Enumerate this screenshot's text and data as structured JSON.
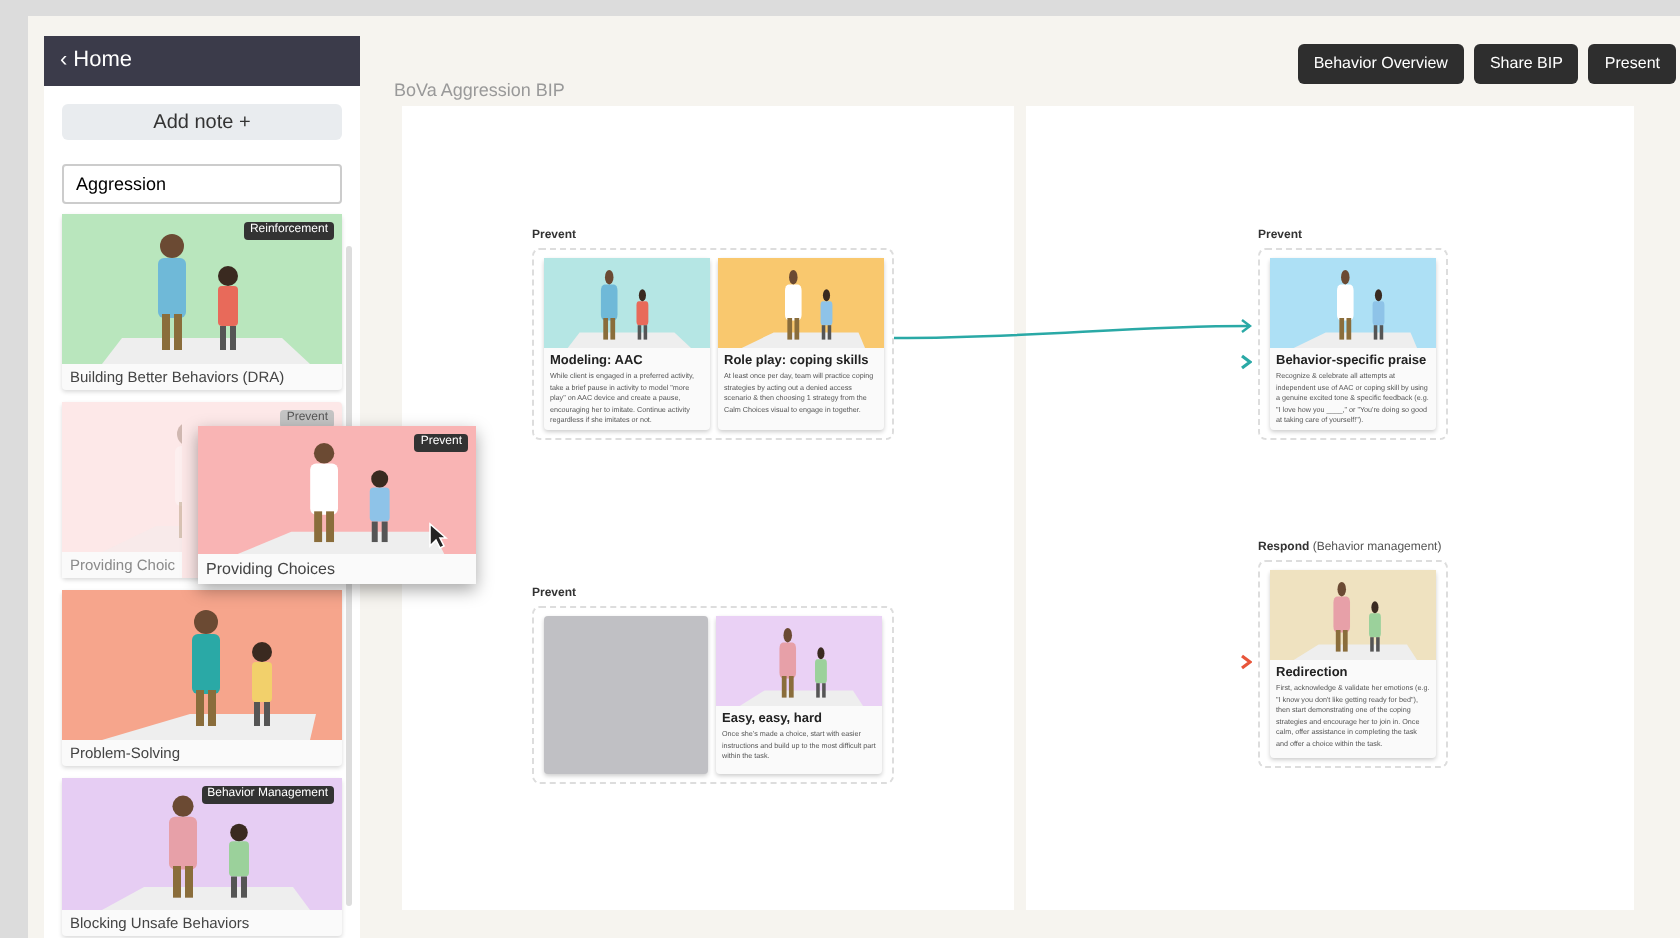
{
  "sidebar": {
    "back_icon": "‹",
    "back_label": "Home",
    "add_button": "Add note +",
    "search": {
      "value": "Aggression"
    },
    "notes": [
      {
        "title": "Building Better Behaviors (DRA)",
        "tag": "Reinforcement",
        "color": "#b9e6bd",
        "faded": false
      },
      {
        "title": "Providing Choic",
        "tag": "Prevent",
        "color": "#fde8e8",
        "faded": true
      },
      {
        "title": "Problem-Solving",
        "color": "#f6a58c",
        "faded": false
      },
      {
        "title": "Blocking Unsafe Behaviors",
        "tag": "Behavior Management",
        "color": "#e6cdf3",
        "faded": false
      }
    ],
    "dragged_note": {
      "title": "Providing Choices",
      "tag": "Prevent",
      "color": "#f9b4b4"
    }
  },
  "header": {
    "title": "BoVa Aggression BIP",
    "buttons": [
      "Behavior Overview",
      "Share BIP",
      "Present"
    ]
  },
  "boards": [
    {
      "groups": [
        {
          "label": "Prevent",
          "outgoing_arrow": true,
          "cards": [
            {
              "kind": "picture",
              "color": "#b5e6e4",
              "title": "Modeling: AAC",
              "text": "While client is engaged in a preferred activity, take a brief pause in activity to model \"more play\" on AAC device and create a pause, encouraging her to imitate. Continue activity regardless if she imitates or not."
            },
            {
              "kind": "picture",
              "color": "#f9c86e",
              "title": "Role play: coping skills",
              "text": "At least once per day, team will practice coping strategies by acting out a denied access scenario & then choosing 1 strategy from the Calm Choices visual to engage in together."
            }
          ]
        },
        {
          "label": "Prevent",
          "cards": [
            {
              "kind": "blank",
              "color": "#c0c0c4"
            },
            {
              "kind": "picture",
              "color": "#ead1f5",
              "title": "Easy, easy, hard",
              "text": "Once she's made a choice, start with easier instructions and build up to the most difficult part within the task."
            }
          ]
        }
      ]
    },
    {
      "groups": [
        {
          "label": "Prevent",
          "color": "#2aa9a6",
          "cards": [
            {
              "kind": "picture",
              "color": "#ade0f5",
              "title": "Behavior-specific praise",
              "text": "Recognize & celebrate all attempts at independent use of AAC or coping skill by using a genuine excited tone & specific feedback (e.g. \"I love how you ____,\" or \"You're doing so good at taking care of yourself!\")."
            }
          ]
        },
        {
          "label": "Respond",
          "sublabel": "(Behavior management)",
          "color": "#e8553a",
          "cards": [
            {
              "kind": "picture",
              "color": "#efe2c0",
              "title": "Redirection",
              "text": "First, acknowledge & validate her emotions (e.g. \"I know you don't like getting ready for bed\"), then start demonstrating one of the coping strategies and encourage her to join in. Once calm, offer assistance in completing the task and offer a choice within the task."
            }
          ]
        }
      ]
    }
  ]
}
